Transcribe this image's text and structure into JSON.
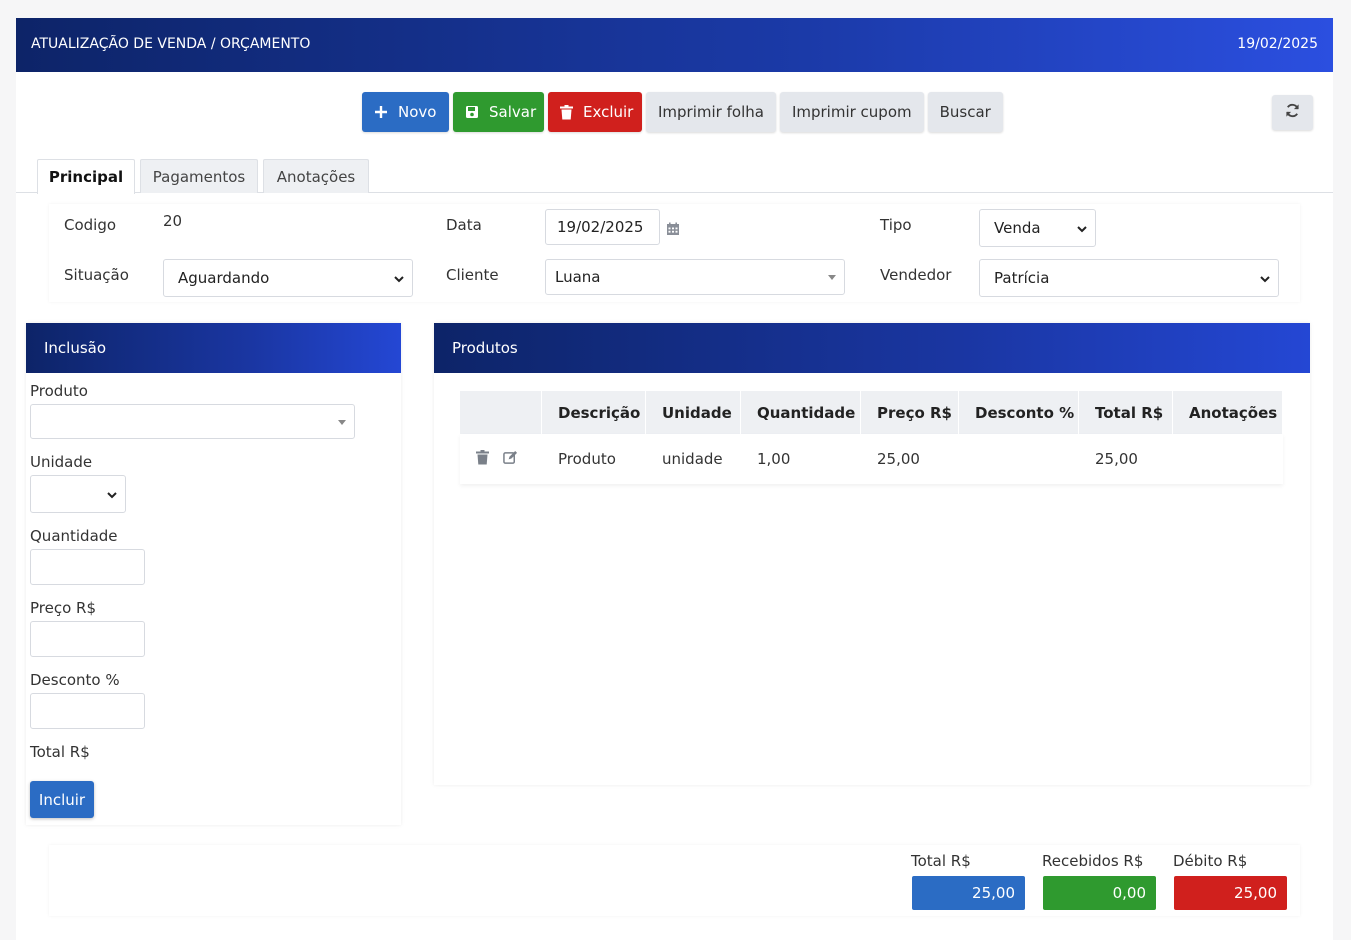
{
  "header": {
    "title": "ATUALIZAÇÃO DE VENDA / ORÇAMENTO",
    "date": "19/02/2025"
  },
  "toolbar": {
    "novo": "Novo",
    "salvar": "Salvar",
    "excluir": "Excluir",
    "imprimir_folha": "Imprimir folha",
    "imprimir_cupom": "Imprimir cupom",
    "buscar": "Buscar"
  },
  "tabs": [
    {
      "label": "Principal",
      "active": true
    },
    {
      "label": "Pagamentos",
      "active": false
    },
    {
      "label": "Anotações",
      "active": false
    }
  ],
  "form": {
    "codigo_label": "Codigo",
    "codigo_value": "20",
    "data_label": "Data",
    "data_value": "19/02/2025",
    "tipo_label": "Tipo",
    "tipo_value": "Venda",
    "situacao_label": "Situação",
    "situacao_value": "Aguardando",
    "cliente_label": "Cliente",
    "cliente_value": "Luana",
    "vendedor_label": "Vendedor",
    "vendedor_value": "Patrícia"
  },
  "inclusao": {
    "title": "Inclusão",
    "produto_label": "Produto",
    "produto_value": "",
    "unidade_label": "Unidade",
    "unidade_value": "",
    "quantidade_label": "Quantidade",
    "quantidade_value": "",
    "preco_label": "Preço R$",
    "preco_value": "",
    "desconto_label": "Desconto %",
    "desconto_value": "",
    "total_label": "Total R$",
    "incluir": "Incluir"
  },
  "produtos": {
    "title": "Produtos",
    "columns": [
      "",
      "Descrição",
      "Unidade",
      "Quantidade",
      "Preço R$",
      "Desconto %",
      "Total R$",
      "Anotações"
    ],
    "rows": [
      {
        "descricao": "Produto",
        "unidade": "unidade",
        "quantidade": "1,00",
        "preco": "25,00",
        "desconto": "",
        "total": "25,00",
        "anotacoes": ""
      }
    ]
  },
  "totals": {
    "total_label": "Total R$",
    "total_value": "25,00",
    "recebidos_label": "Recebidos R$",
    "recebidos_value": "0,00",
    "debito_label": "Débito R$",
    "debito_value": "25,00"
  },
  "colors": {
    "header": "#0d2468",
    "primary": "#2b6cc4",
    "success": "#2f9a2f",
    "danger": "#d0201d"
  },
  "icons": [
    "plus-icon",
    "save-icon",
    "trash-icon",
    "refresh-icon",
    "calendar-icon",
    "chevron-down-icon",
    "edit-icon"
  ]
}
